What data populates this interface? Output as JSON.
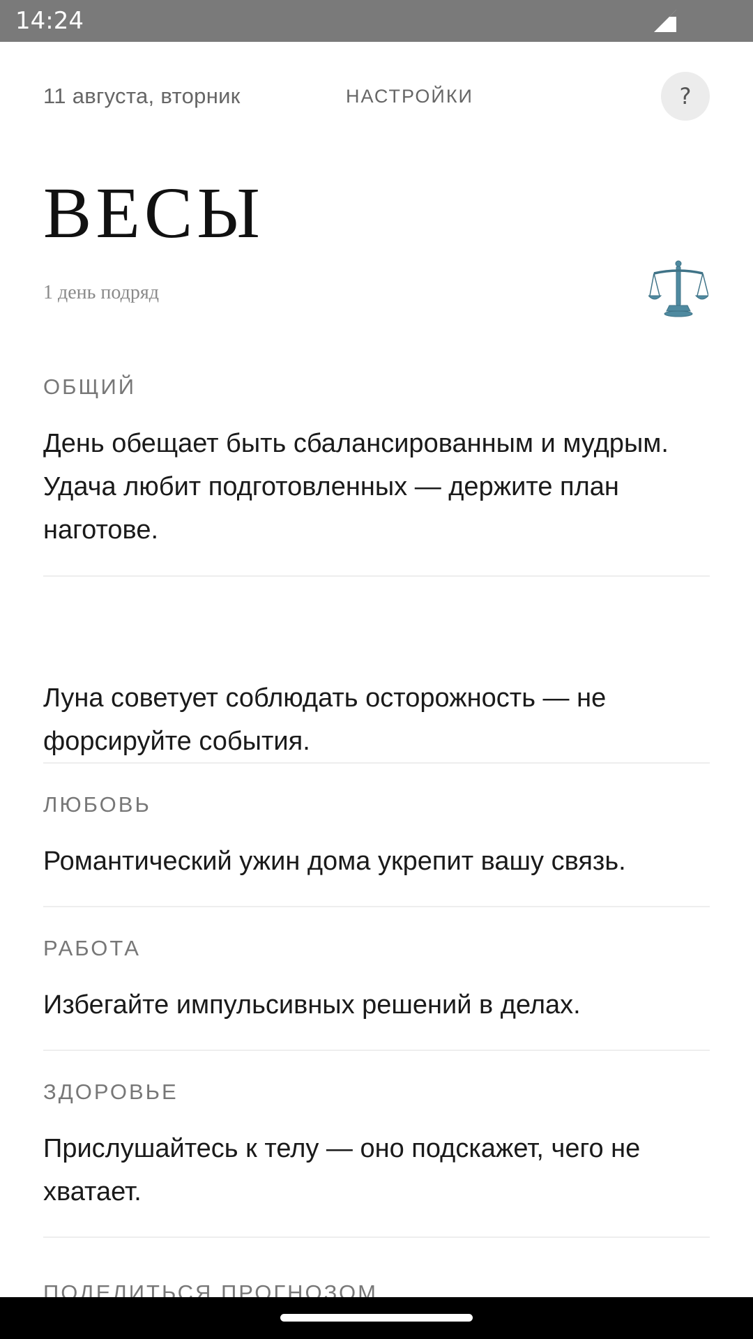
{
  "status_bar": {
    "time": "14:24"
  },
  "header": {
    "date": "11 августа, вторник",
    "settings_label": "НАСТРОЙКИ",
    "help_label": "?"
  },
  "sign": {
    "title": "ВЕСЫ",
    "streak": "1 день подряд",
    "icon": "libra-scales-icon"
  },
  "sections": {
    "general": {
      "label": "ОБЩИЙ",
      "text": "День обещает быть сбалансированным и мудрым. Удача любит подготовленных — держите план наготове."
    },
    "moon": {
      "text": "Луна советует соблюдать осторожность — не форсируйте события."
    },
    "love": {
      "label": "ЛЮБОВЬ",
      "text": "Романтический ужин дома укрепит вашу связь."
    },
    "work": {
      "label": "РАБОТА",
      "text": "Избегайте импульсивных решений в делах."
    },
    "health": {
      "label": "ЗДОРОВЬЕ",
      "text": "Прислушайтесь к телу — оно подскажет, чего не хватает."
    }
  },
  "share": {
    "label": "ПОДЕЛИТЬСЯ ПРОГНОЗОМ"
  },
  "colors": {
    "status_bar": "#7a7a7a",
    "accent_icon": "#4f8aa0",
    "text_primary": "#1a1a1a",
    "text_secondary": "#777777"
  }
}
